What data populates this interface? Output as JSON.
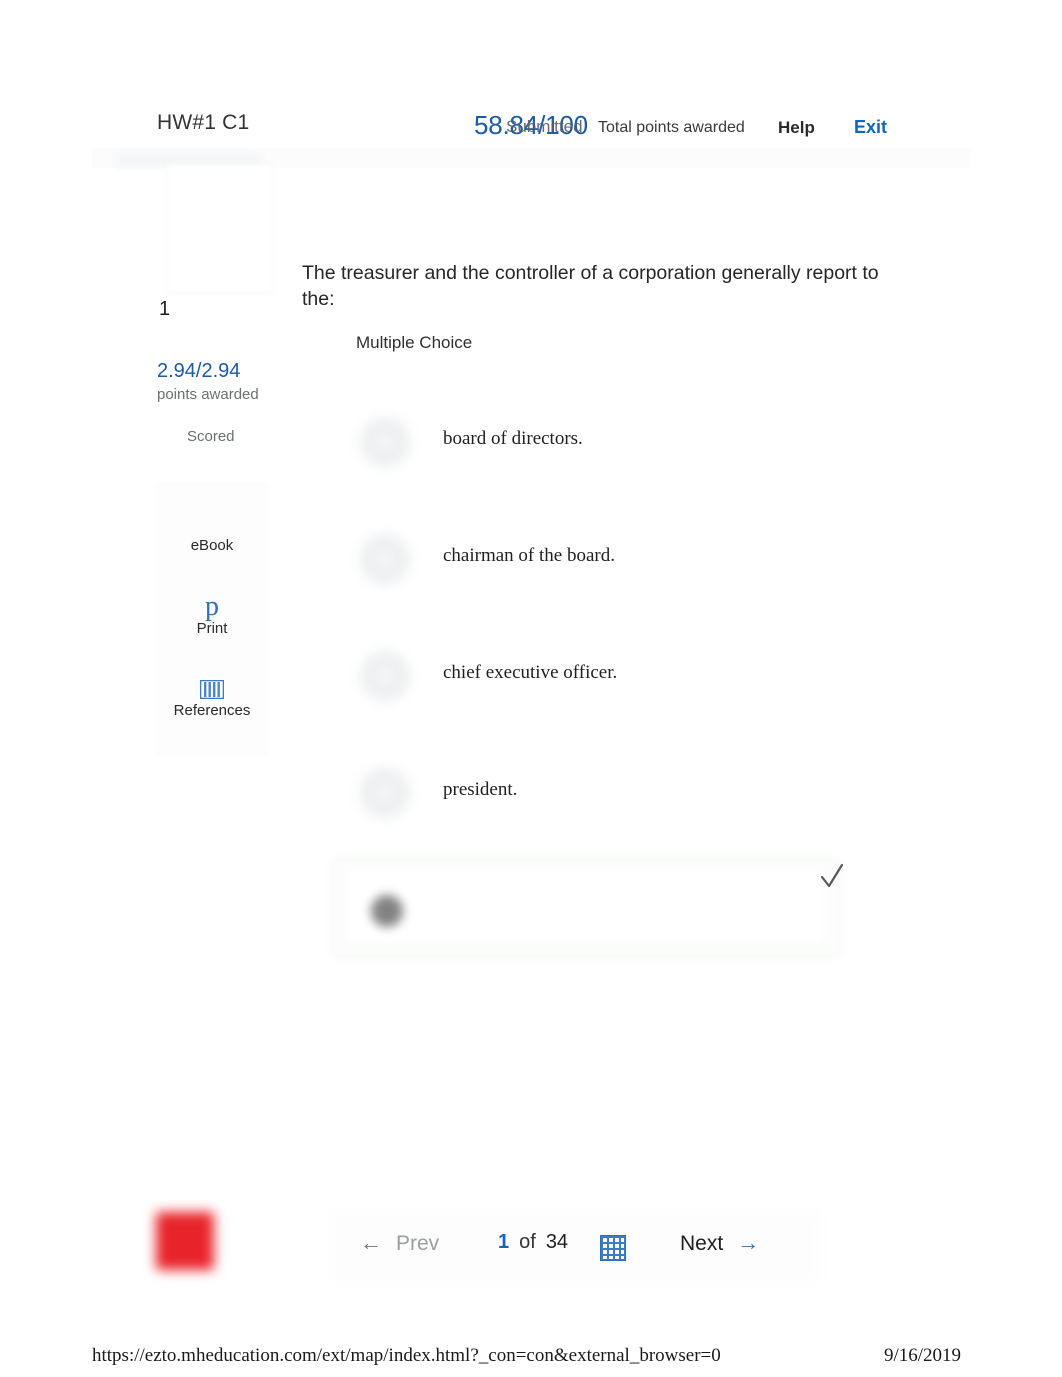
{
  "header": {
    "assignment_title": "HW#1 C1",
    "score": "58.84/100",
    "submitted_overlay": "Submitted",
    "score_caption": "Total points awarded",
    "help_label": "Help",
    "exit_label": "Exit",
    "score_color": "#1d5ba4",
    "link_color": "#1565c0"
  },
  "sidebar": {
    "question_number": "1",
    "points": "2.94/2.94",
    "points_label": "points awarded",
    "status": "Scored",
    "tools": [
      {
        "label": "eBook",
        "icon": "ebook-icon"
      },
      {
        "label": "Print",
        "icon": "print-icon"
      },
      {
        "label": "References",
        "icon": "references-icon"
      }
    ]
  },
  "question": {
    "stem": "The treasurer and the controller of a corporation generally report to the:",
    "type": "Multiple Choice",
    "choices": [
      {
        "text": "board of directors."
      },
      {
        "text": "chairman of the board."
      },
      {
        "text": "chief executive officer."
      },
      {
        "text": "president."
      }
    ],
    "selected_answer_redacted": "",
    "correct_mark": "✓"
  },
  "navigation": {
    "prev_label": "Prev",
    "prev_arrow": "←",
    "current_page": "1",
    "of_label": "of",
    "total_pages": "34",
    "next_label": "Next",
    "next_arrow": "→",
    "grid_icon": "question-grid-icon"
  },
  "footer": {
    "url": "https://ezto.mheducation.com/ext/map/index.html?_con=con&external_browser=0",
    "date": "9/16/2019"
  }
}
